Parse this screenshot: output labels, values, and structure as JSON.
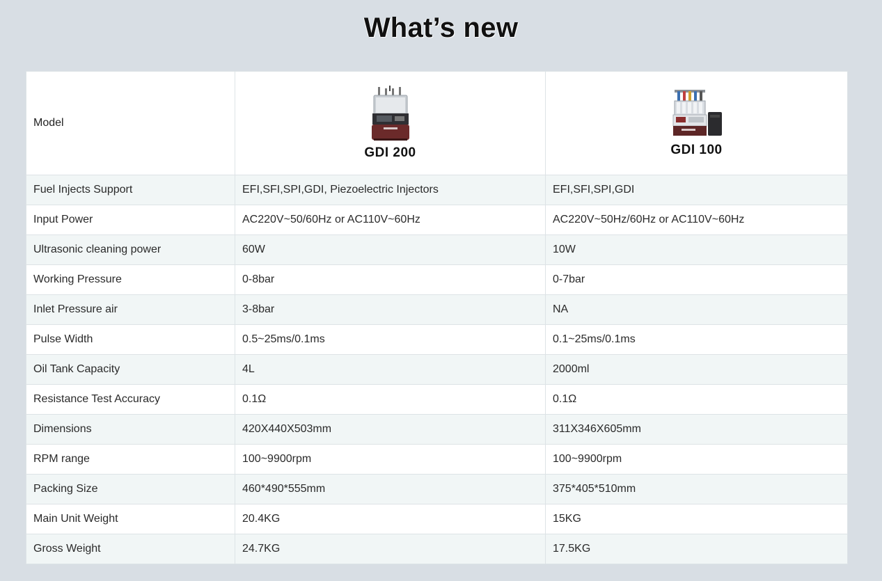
{
  "title": "What’s new",
  "table": {
    "model_label": "Model",
    "products": [
      {
        "name": "GDI 200",
        "image": "gdi-200-machine-image"
      },
      {
        "name": "GDI 100",
        "image": "gdi-100-machine-image"
      }
    ],
    "rows": [
      {
        "label": "Fuel Injects Support",
        "gdi200": "EFI,SFI,SPI,GDI, Piezoelectric Injectors",
        "gdi100": "EFI,SFI,SPI,GDI"
      },
      {
        "label": "Input Power",
        "gdi200": "AC220V~50/60Hz or AC110V~60Hz",
        "gdi100": "AC220V~50Hz/60Hz or AC110V~60Hz"
      },
      {
        "label": "Ultrasonic cleaning power",
        "gdi200": "60W",
        "gdi100": "10W"
      },
      {
        "label": "Working Pressure",
        "gdi200": "0-8bar",
        "gdi100": "0-7bar"
      },
      {
        "label": "Inlet Pressure air",
        "gdi200": "3-8bar",
        "gdi100": "NA"
      },
      {
        "label": "Pulse Width",
        "gdi200": "0.5~25ms/0.1ms",
        "gdi100": "0.1~25ms/0.1ms"
      },
      {
        "label": "Oil Tank Capacity",
        "gdi200": "4L",
        "gdi100": "2000ml"
      },
      {
        "label": "Resistance Test Accuracy",
        "gdi200": "0.1Ω",
        "gdi100": "0.1Ω"
      },
      {
        "label": "Dimensions",
        "gdi200": "420X440X503mm",
        "gdi100": "311X346X605mm"
      },
      {
        "label": "RPM range",
        "gdi200": "100~9900rpm",
        "gdi100": "100~9900rpm"
      },
      {
        "label": "Packing Size",
        "gdi200": "460*490*555mm",
        "gdi100": "375*405*510mm"
      },
      {
        "label": "Main Unit Weight",
        "gdi200": "20.4KG",
        "gdi100": "15KG"
      },
      {
        "label": "Gross Weight",
        "gdi200": "24.7KG",
        "gdi100": "17.5KG"
      }
    ]
  }
}
